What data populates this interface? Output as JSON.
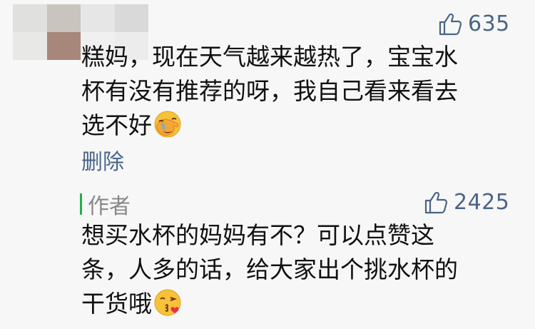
{
  "comments": [
    {
      "likes": "635",
      "text_lines": [
        "糕妈，现在天气越来越热了，宝宝水",
        "杯有没有推荐的呀，我自己看来看去",
        "选不好"
      ],
      "emoji": "facepalm-laughing-emoji",
      "delete_label": "删除"
    }
  ],
  "reply": {
    "author_label": "作者",
    "likes": "2425",
    "text_lines": [
      "想买水杯的妈妈有不？可以点赞这",
      "条，人多的话，给大家出个挑水杯的",
      "干货哦"
    ],
    "emoji": "kissing-heart-emoji"
  },
  "colors": {
    "link_blue": "#4a6587",
    "author_green": "#21b14a",
    "author_gray": "#888888",
    "background": "#f7f7f7"
  },
  "icons": {
    "like": "thumbs-up-icon"
  }
}
